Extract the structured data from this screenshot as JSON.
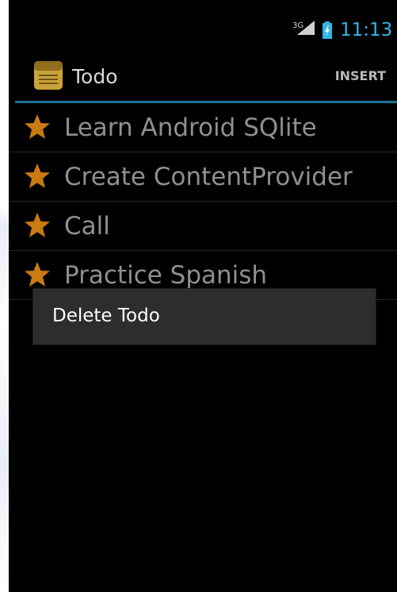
{
  "status_bar": {
    "network": "3G",
    "time": "11:13",
    "icons": [
      "signal-icon",
      "battery-charging-icon"
    ]
  },
  "action_bar": {
    "title": "Todo",
    "app_icon": "notepad-icon",
    "action": "INSERT"
  },
  "todos": [
    {
      "label": "Learn Android SQlite",
      "icon": "star-icon"
    },
    {
      "label": "Create ContentProvider",
      "icon": "star-icon"
    },
    {
      "label": "Call",
      "icon": "star-icon"
    },
    {
      "label": "Practice Spanish",
      "icon": "star-icon"
    }
  ],
  "context_menu": {
    "items": [
      {
        "label": "Delete Todo"
      }
    ]
  },
  "colors": {
    "accent": "#33b5e5",
    "divider": "#1b6f95",
    "star": "#c97a12",
    "menu_bg": "#2d2d2d"
  }
}
